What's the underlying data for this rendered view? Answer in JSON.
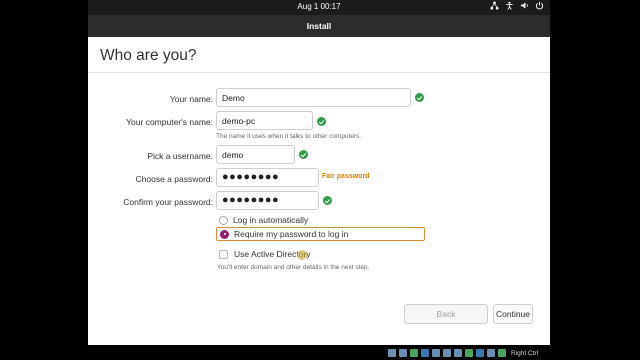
{
  "top_bar": {
    "datetime": "Aug 1  00:17"
  },
  "window": {
    "title": "Install"
  },
  "page": {
    "title": "Who are you?"
  },
  "form": {
    "name_label": "Your name:",
    "name_value": "Demo",
    "computer_label": "Your computer's name:",
    "computer_value": "demo-pc",
    "computer_hint": "The name it uses when it talks to other computers.",
    "username_label": "Pick a username:",
    "username_value": "demo",
    "password_label": "Choose a password:",
    "password_value": "●●●●●●●●",
    "password_strength": "Fair password",
    "confirm_label": "Confirm your password:",
    "confirm_value": "●●●●●●●●",
    "login_auto_label": "Log in automatically",
    "login_require_label": "Require my password to log in",
    "login_selected": "require",
    "active_directory_label": "Use Active Directory",
    "active_directory_checked": false,
    "active_directory_hint": "You'll enter domain and other details in the next step."
  },
  "buttons": {
    "back": "Back",
    "continue": "Continue"
  },
  "vm_status": {
    "host_key": "Right Ctrl"
  },
  "colors": {
    "accent": "#8f1f6a",
    "valid": "#2f9b47",
    "warning": "#e07b00"
  }
}
